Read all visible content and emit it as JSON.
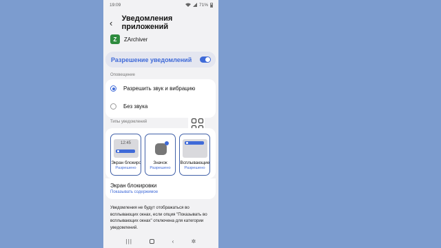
{
  "status_bar": {
    "time": "19:09",
    "battery": "71%"
  },
  "header": {
    "back": "‹",
    "title": "Уведомления приложений"
  },
  "app": {
    "logo_letter": "Z",
    "name": "ZArchiver"
  },
  "permission": {
    "label": "Разрешение уведомлений",
    "enabled": true
  },
  "alerts": {
    "section_label": "Оповещение",
    "options": [
      {
        "label": "Разрешить звук и вибрацию",
        "selected": true
      },
      {
        "label": "Без звука",
        "selected": false
      }
    ]
  },
  "types": {
    "section_label": "Типы уведомлений",
    "tiles": [
      {
        "name": "Экран блокировки",
        "status": "Разрешено",
        "preview_time": "12:45"
      },
      {
        "name": "Значок",
        "status": "Разрешено"
      },
      {
        "name": "Всплывающие",
        "status": "Разрешено"
      }
    ]
  },
  "lock_screen": {
    "title": "Экран блокировки",
    "subtitle": "Показывать содержимое"
  },
  "note": "Уведомления не будут отображаться во всплывающих окнах, если опция \"Показывать во всплывающих окнах\" отключена для категории уведомлений.",
  "nav": {
    "recent": "|||",
    "back": "‹",
    "accessibility": "✲"
  },
  "colors": {
    "accent": "#3f6ad8",
    "background": "#7c9ccf"
  }
}
